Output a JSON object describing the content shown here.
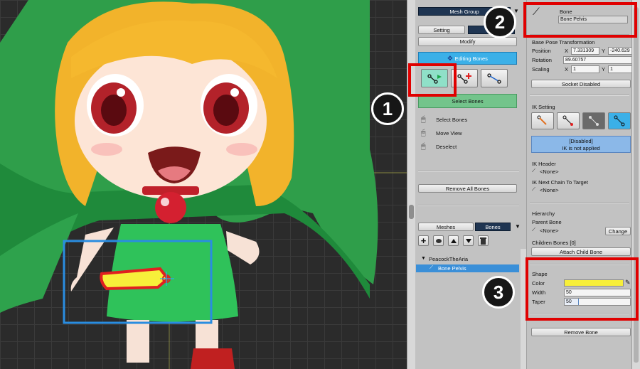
{
  "colors": {
    "accent_blue": "#3bb0e8",
    "select_green": "#73c48b",
    "highlight_red": "#e00000",
    "shape_yellow": "#f7ef3a",
    "ik_disabled": "#8bb8e8"
  },
  "mid_panel": {
    "mesh_group_label": "Mesh Group",
    "setting_tab": "Setting",
    "modify_button": "Modify",
    "editing_bones_button": "Editing Bones",
    "select_bones_button": "Select Bones",
    "hints": [
      {
        "icon": "mouse-left-icon",
        "text": "Select Bones"
      },
      {
        "icon": "mouse-middle-icon",
        "text": "Move View"
      },
      {
        "icon": "mouse-right-icon",
        "text": "Deselect"
      }
    ],
    "remove_all_bones_button": "Remove All Bones",
    "bottom_tabs": {
      "meshes": "Meshes",
      "bones": "Bones"
    },
    "tree": {
      "root": "PeacockTheAria",
      "selected_bone": "Bone Pelvis"
    }
  },
  "right_panel": {
    "header_type": "Bone",
    "bone_name": "Bone Pelvis",
    "base_pose_title": "Base Pose Transformation",
    "position_label": "Position",
    "position_x": "7.331309",
    "position_y": "-240.629",
    "rotation_label": "Rotation",
    "rotation_value": "89.60757",
    "scaling_label": "Scaling",
    "scaling_x": "1",
    "scaling_y": "1",
    "axis_x": "X",
    "axis_y": "Y",
    "socket_button": "Socket Disabled",
    "ik_setting_title": "IK Setting",
    "ik_status_line1": "[Disabled]",
    "ik_status_line2": "IK is not applied",
    "ik_header_label": "IK Header",
    "ik_header_value": "<None>",
    "ik_next_chain_label": "IK Next Chain To Target",
    "ik_next_chain_value": "<None>",
    "hierarchy_title": "Hierarchy",
    "parent_bone_label": "Parent Bone",
    "parent_bone_value": "<None>",
    "change_button": "Change",
    "children_bones_label": "Children Bones [0]",
    "attach_child_button": "Attach Child Bone",
    "shape_title": "Shape",
    "color_label": "Color",
    "width_label": "Width",
    "width_value": "50",
    "taper_label": "Taper",
    "taper_value": "50",
    "taper_fraction": 0.22,
    "remove_bone_button": "Remove Bone"
  },
  "callouts": [
    "1",
    "2",
    "3"
  ]
}
